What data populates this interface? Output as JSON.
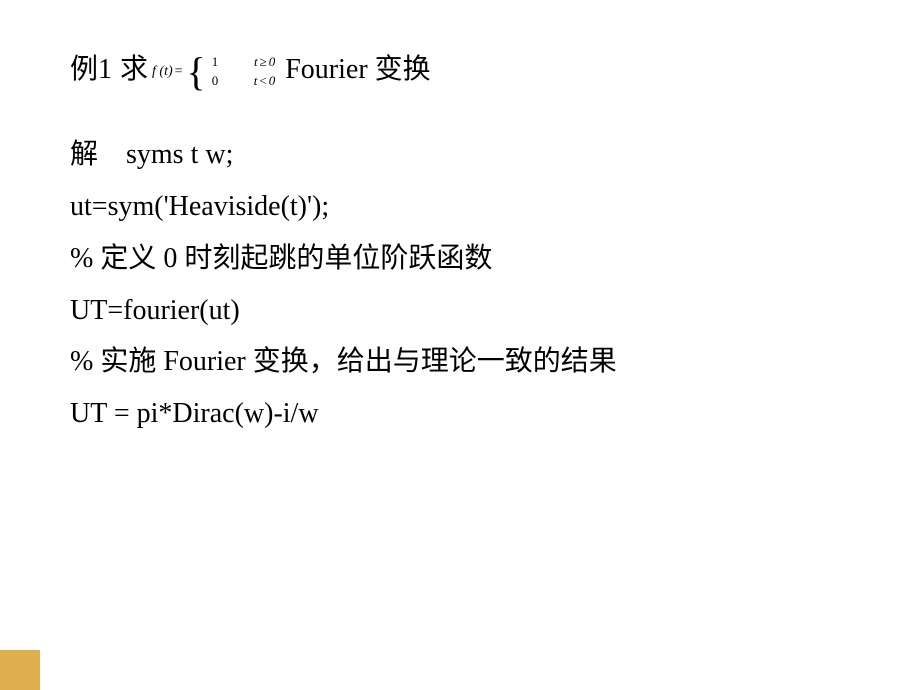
{
  "title": {
    "example_label": "例1",
    "qiu": "求",
    "formula": {
      "ft": "f (t)",
      "eq": "=",
      "case1_val": "1",
      "case1_cond_t": "t",
      "case1_cond_op": "≥",
      "case1_cond_zero": "0",
      "case2_val": "0",
      "case2_cond_t": "t",
      "case2_cond_op": "<",
      "case2_cond_zero": "0"
    },
    "fourier_label": "Fourier 变换"
  },
  "lines": {
    "l1": "解 syms t w;",
    "l2": "ut=sym('Heaviside(t)');",
    "l3": "% 定义 0 时刻起跳的单位阶跃函数",
    "l4": "UT=fourier(ut)",
    "l5": "% 实施 Fourier 变换，给出与理论一致的结果",
    "l6": "UT = pi*Dirac(w)-i/w"
  }
}
